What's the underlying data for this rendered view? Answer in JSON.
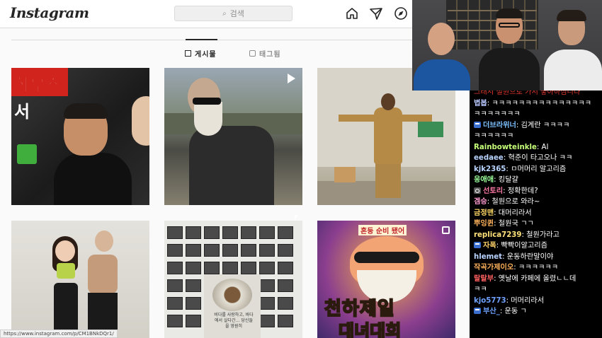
{
  "instagram": {
    "logo": "Instagram",
    "search_placeholder": "검색",
    "nav_icons": [
      "home-icon",
      "direct-icon",
      "explore-icon"
    ],
    "tabs": [
      {
        "label": "게시물",
        "active": true
      },
      {
        "label": "태그됨",
        "active": false
      }
    ],
    "post_texts": {
      "p1_line1": "하우스",
      "p1_line2": "서",
      "p5_caption": "비다를 사랑하고, 바다에서 살다간… 당신들을 영원히",
      "p6_top": "혼둥 순비 됐어",
      "p6_title1": "천하제일",
      "p6_title2": "대녀대회"
    },
    "status_url": "https://www.instagram.com/p/CM1BNkDQr1/"
  },
  "chat": {
    "messages": [
      {
        "nick": "",
        "text": "그래서 철원으로 가서 좋아하심니다",
        "color": "#e0382f",
        "badge": false
      },
      {
        "nick": "볍봅",
        "text": "ㅋㅋㅋㅋㅋㅋㅋㅋㅋㅋㅋㅋㅋㅋㅋ",
        "color": "#b9c9ff",
        "badge": false
      },
      {
        "nick": "",
        "text": "ㅋㅋㅋㅋㅋㅋㅋ",
        "color": "#fff",
        "badge": false
      },
      {
        "nick": "더브라위너",
        "text": "김계란 ㅋㅋㅋㅋ",
        "color": "#7ec0ff",
        "badge": true
      },
      {
        "nick": "",
        "text": "ㅋㅋㅋㅋㅋㅋ",
        "color": "#fff",
        "badge": false
      },
      {
        "nick": "Rainbowteinkle",
        "text": "AI",
        "color": "#c6ff7a",
        "badge": false
      },
      {
        "nick": "eedaee",
        "text": "혁준이 타고오나 ㅋㅋ",
        "color": "#b9d4ff",
        "badge": false
      },
      {
        "nick": "kjk2365",
        "text": "ㅁ머머리 알고리즘",
        "color": "#b9d4ff",
        "badge": false
      },
      {
        "nick": "응애애",
        "text": "킹달걀",
        "color": "#9dff9d",
        "badge": false
      },
      {
        "nick": "선토리",
        "text": "정확한데?",
        "color": "#ff7aa8",
        "badge": "alt"
      },
      {
        "nick": "겜승",
        "text": "철원으로 와라~",
        "color": "#ff9ad0",
        "badge": false
      },
      {
        "nick": "금정맨",
        "text": "대머리라서",
        "color": "#ffd766",
        "badge": false
      },
      {
        "nick": "뿌잉퀸",
        "text": "철원국 ㄱㄱ",
        "color": "#ffb35c",
        "badge": false
      },
      {
        "nick": "replica7239",
        "text": "철원가라고",
        "color": "#ffe27a",
        "badge": false
      },
      {
        "nick": "자폭",
        "text": "빡빡이알고리즘",
        "color": "#ffd36b",
        "badge": true
      },
      {
        "nick": "hlemet",
        "text": "운동하란말이야",
        "color": "#b9d4ff",
        "badge": false
      },
      {
        "nick": "작곡가제이오",
        "text": "ㅋㅋㅋㅋㅋㅋ",
        "color": "#ffb35c",
        "badge": false
      },
      {
        "nick": "랄랄부",
        "text": "옛날에 카페에 올렸ㄴㄴ데",
        "color": "#ff6060",
        "badge": false
      },
      {
        "nick": "",
        "text": "ㅋㅋ",
        "color": "#fff",
        "badge": false
      },
      {
        "nick": "kjo5773",
        "text": "머머리라서",
        "color": "#6fa2ff",
        "badge": false
      },
      {
        "nick": "부산_",
        "text": "운동 ㄱ",
        "color": "#6fa2ff",
        "badge": true
      }
    ]
  }
}
